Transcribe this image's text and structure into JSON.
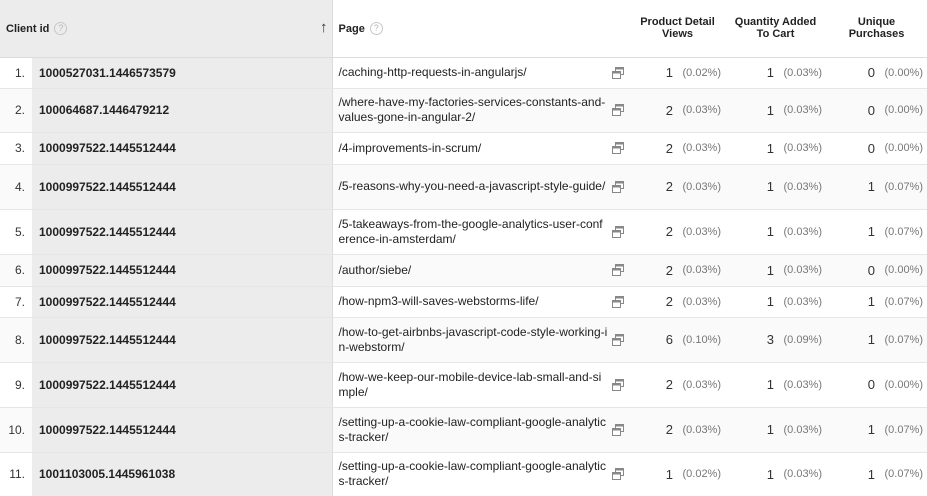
{
  "header": {
    "client_id": "Client id",
    "page": "Page",
    "product_detail_views": "Product Detail Views",
    "quantity_added_to_cart": "Quantity Added To Cart",
    "unique_purchases": "Unique Purchases",
    "help_glyph": "?"
  },
  "rows": [
    {
      "num": "1.",
      "client": "1000527031.1446573579",
      "page": "/caching-http-requests-in-angularjs/",
      "pdv": "1",
      "pdv_pct": "(0.02%)",
      "qty": "1",
      "qty_pct": "(0.03%)",
      "uniq": "0",
      "uniq_pct": "(0.00%)"
    },
    {
      "num": "2.",
      "client": "100064687.1446479212",
      "page": "/where-have-my-factories-services-constants-and-values-gone-in-angular-2/",
      "pdv": "2",
      "pdv_pct": "(0.03%)",
      "qty": "1",
      "qty_pct": "(0.03%)",
      "uniq": "0",
      "uniq_pct": "(0.00%)"
    },
    {
      "num": "3.",
      "client": "1000997522.1445512444",
      "page": "/4-improvements-in-scrum/",
      "pdv": "2",
      "pdv_pct": "(0.03%)",
      "qty": "1",
      "qty_pct": "(0.03%)",
      "uniq": "0",
      "uniq_pct": "(0.00%)"
    },
    {
      "num": "4.",
      "client": "1000997522.1445512444",
      "page": "/5-reasons-why-you-need-a-javascript-style-guide/",
      "pdv": "2",
      "pdv_pct": "(0.03%)",
      "qty": "1",
      "qty_pct": "(0.03%)",
      "uniq": "1",
      "uniq_pct": "(0.07%)"
    },
    {
      "num": "5.",
      "client": "1000997522.1445512444",
      "page": "/5-takeaways-from-the-google-analytics-user-conference-in-amsterdam/",
      "pdv": "2",
      "pdv_pct": "(0.03%)",
      "qty": "1",
      "qty_pct": "(0.03%)",
      "uniq": "1",
      "uniq_pct": "(0.07%)"
    },
    {
      "num": "6.",
      "client": "1000997522.1445512444",
      "page": "/author/siebe/",
      "pdv": "2",
      "pdv_pct": "(0.03%)",
      "qty": "1",
      "qty_pct": "(0.03%)",
      "uniq": "0",
      "uniq_pct": "(0.00%)"
    },
    {
      "num": "7.",
      "client": "1000997522.1445512444",
      "page": "/how-npm3-will-saves-webstorms-life/",
      "pdv": "2",
      "pdv_pct": "(0.03%)",
      "qty": "1",
      "qty_pct": "(0.03%)",
      "uniq": "1",
      "uniq_pct": "(0.07%)"
    },
    {
      "num": "8.",
      "client": "1000997522.1445512444",
      "page": "/how-to-get-airbnbs-javascript-code-style-working-in-webstorm/",
      "pdv": "6",
      "pdv_pct": "(0.10%)",
      "qty": "3",
      "qty_pct": "(0.09%)",
      "uniq": "1",
      "uniq_pct": "(0.07%)"
    },
    {
      "num": "9.",
      "client": "1000997522.1445512444",
      "page": "/how-we-keep-our-mobile-device-lab-small-and-simple/",
      "pdv": "2",
      "pdv_pct": "(0.03%)",
      "qty": "1",
      "qty_pct": "(0.03%)",
      "uniq": "0",
      "uniq_pct": "(0.00%)"
    },
    {
      "num": "10.",
      "client": "1000997522.1445512444",
      "page": "/setting-up-a-cookie-law-compliant-google-analytics-tracker/",
      "pdv": "2",
      "pdv_pct": "(0.03%)",
      "qty": "1",
      "qty_pct": "(0.03%)",
      "uniq": "1",
      "uniq_pct": "(0.07%)"
    },
    {
      "num": "11.",
      "client": "1001103005.1445961038",
      "page": "/setting-up-a-cookie-law-compliant-google-analytics-tracker/",
      "pdv": "1",
      "pdv_pct": "(0.02%)",
      "qty": "1",
      "qty_pct": "(0.03%)",
      "uniq": "1",
      "uniq_pct": "(0.07%)"
    }
  ]
}
